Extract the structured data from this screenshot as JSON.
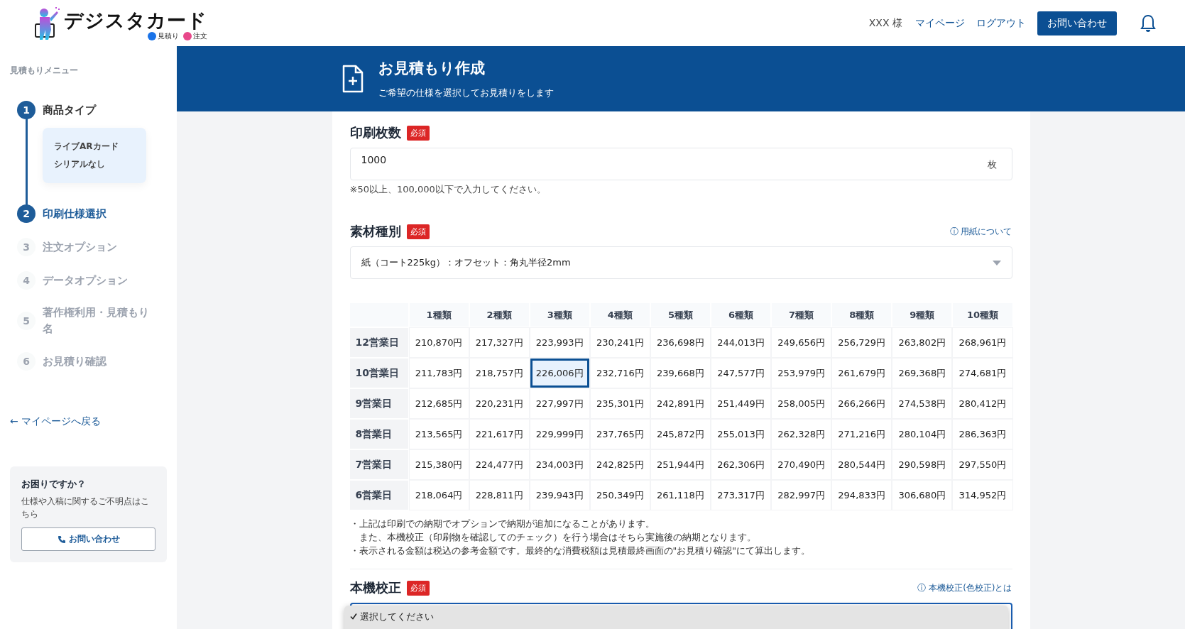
{
  "header": {
    "logo": {
      "title": "デジスタカード",
      "links": [
        {
          "label": "見積り",
          "color": "#1a73e8"
        },
        {
          "label": "注文",
          "color": "#e8488a"
        }
      ]
    },
    "user": "XXX 様",
    "nav": [
      "マイページ",
      "ログアウト"
    ],
    "contact_button": "お問い合わせ"
  },
  "sidebar": {
    "heading": "見積もりメニュー",
    "steps": [
      {
        "number": "1",
        "label": "商品タイプ",
        "done": true,
        "selected": false,
        "summary": [
          "ライブARカード",
          "シリアルなし"
        ]
      },
      {
        "number": "2",
        "label": "印刷仕様選択",
        "done": false,
        "selected": true
      },
      {
        "number": "3",
        "label": "注文オプション",
        "done": false,
        "selected": false
      },
      {
        "number": "4",
        "label": "データオプション",
        "done": false,
        "selected": false
      },
      {
        "number": "5",
        "label": "著作権利用・見積もり名",
        "done": false,
        "selected": false
      },
      {
        "number": "6",
        "label": "お見積り確認",
        "done": false,
        "selected": false
      }
    ],
    "back_link": "← マイページへ戻る",
    "help": {
      "title": "お困りですか？",
      "text": "仕様や入稿に関するご不明点はこちら",
      "button": "お問い合わせ"
    }
  },
  "banner": {
    "title": "お見積もり作成",
    "subtitle": "ご希望の仕様を選択してお見積りをします"
  },
  "quantity": {
    "label": "印刷枚数",
    "required": "必須",
    "value": "1000",
    "unit": "枚",
    "hint": "※50以上、100,000以下で入力してください。"
  },
  "material": {
    "label": "素材種別",
    "required": "必須",
    "info_link": "ⓘ 用紙について",
    "value": "紙（コート225kg）：オフセット：角丸半径2mm"
  },
  "price_table": {
    "columns": [
      "1種類",
      "2種類",
      "3種類",
      "4種類",
      "5種類",
      "6種類",
      "7種類",
      "8種類",
      "9種類",
      "10種類"
    ],
    "rows": [
      {
        "label": "12営業日",
        "cells": [
          {
            "value": "210,870円",
            "selected": false
          },
          {
            "value": "217,327円",
            "selected": false
          },
          {
            "value": "223,993円",
            "selected": false
          },
          {
            "value": "230,241円",
            "selected": false
          },
          {
            "value": "236,698円",
            "selected": false
          },
          {
            "value": "244,013円",
            "selected": false
          },
          {
            "value": "249,656円",
            "selected": false
          },
          {
            "value": "256,729円",
            "selected": false
          },
          {
            "value": "263,802円",
            "selected": false
          },
          {
            "value": "268,961円",
            "selected": false
          }
        ]
      },
      {
        "label": "10営業日",
        "cells": [
          {
            "value": "211,783円",
            "selected": false
          },
          {
            "value": "218,757円",
            "selected": false
          },
          {
            "value": "226,006円",
            "selected": true
          },
          {
            "value": "232,716円",
            "selected": false
          },
          {
            "value": "239,668円",
            "selected": false
          },
          {
            "value": "247,577円",
            "selected": false
          },
          {
            "value": "253,979円",
            "selected": false
          },
          {
            "value": "261,679円",
            "selected": false
          },
          {
            "value": "269,368円",
            "selected": false
          },
          {
            "value": "274,681円",
            "selected": false
          }
        ]
      },
      {
        "label": "9営業日",
        "cells": [
          {
            "value": "212,685円",
            "selected": false
          },
          {
            "value": "220,231円",
            "selected": false
          },
          {
            "value": "227,997円",
            "selected": false
          },
          {
            "value": "235,301円",
            "selected": false
          },
          {
            "value": "242,891円",
            "selected": false
          },
          {
            "value": "251,449円",
            "selected": false
          },
          {
            "value": "258,005円",
            "selected": false
          },
          {
            "value": "266,266円",
            "selected": false
          },
          {
            "value": "274,538円",
            "selected": false
          },
          {
            "value": "280,412円",
            "selected": false
          }
        ]
      },
      {
        "label": "8営業日",
        "cells": [
          {
            "value": "213,565円",
            "selected": false
          },
          {
            "value": "221,617円",
            "selected": false
          },
          {
            "value": "229,999円",
            "selected": false
          },
          {
            "value": "237,765円",
            "selected": false
          },
          {
            "value": "245,872円",
            "selected": false
          },
          {
            "value": "255,013円",
            "selected": false
          },
          {
            "value": "262,328円",
            "selected": false
          },
          {
            "value": "271,216円",
            "selected": false
          },
          {
            "value": "280,104円",
            "selected": false
          },
          {
            "value": "286,363円",
            "selected": false
          }
        ]
      },
      {
        "label": "7営業日",
        "cells": [
          {
            "value": "215,380円",
            "selected": false
          },
          {
            "value": "224,477円",
            "selected": false
          },
          {
            "value": "234,003円",
            "selected": false
          },
          {
            "value": "242,825円",
            "selected": false
          },
          {
            "value": "251,944円",
            "selected": false
          },
          {
            "value": "262,306円",
            "selected": false
          },
          {
            "value": "270,490円",
            "selected": false
          },
          {
            "value": "280,544円",
            "selected": false
          },
          {
            "value": "290,598円",
            "selected": false
          },
          {
            "value": "297,550円",
            "selected": false
          }
        ]
      },
      {
        "label": "6営業日",
        "cells": [
          {
            "value": "218,064円",
            "selected": false
          },
          {
            "value": "228,811円",
            "selected": false
          },
          {
            "value": "239,943円",
            "selected": false
          },
          {
            "value": "250,349円",
            "selected": false
          },
          {
            "value": "261,118円",
            "selected": false
          },
          {
            "value": "273,317円",
            "selected": false
          },
          {
            "value": "282,997円",
            "selected": false
          },
          {
            "value": "294,833円",
            "selected": false
          },
          {
            "value": "306,680円",
            "selected": false
          },
          {
            "value": "314,952円",
            "selected": false
          }
        ]
      }
    ],
    "notes": [
      "・上記は印刷での納期でオプションで納期が追加になることがあります。",
      "　また、本機校正（印刷物を確認してのチェック）を行う場合はそちら実施後の納期となります。",
      "・表示される金額は税込の参考金額です。最終的な消費税額は見積最終画面の\"お見積り確認\"にて算出します。"
    ]
  },
  "proof": {
    "label": "本機校正",
    "required": "必須",
    "info_link": "ⓘ 本機校正(色校正)とは",
    "options": [
      {
        "label": "選択してください",
        "selected": true
      }
    ]
  }
}
